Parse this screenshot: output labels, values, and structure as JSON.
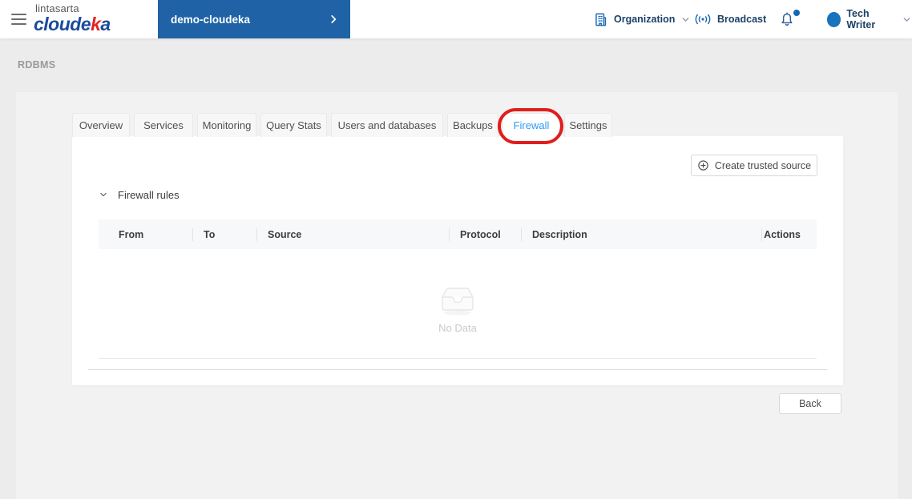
{
  "header": {
    "brand": {
      "top": "lintasarta",
      "name_prefix": "cloude",
      "name_accent": "k",
      "name_suffix": "a"
    },
    "project": {
      "label": "demo-cloudeka"
    },
    "organization_label": "Organization",
    "broadcast_label": "Broadcast",
    "user_name": "Tech Writer",
    "notification_dot": true
  },
  "breadcrumb": "RDBMS",
  "tabs": [
    {
      "label": "Overview",
      "active": false
    },
    {
      "label": "Services",
      "active": false
    },
    {
      "label": "Monitoring",
      "active": false
    },
    {
      "label": "Query Stats",
      "active": false
    },
    {
      "label": "Users and databases",
      "active": false
    },
    {
      "label": "Backups",
      "active": false
    },
    {
      "label": "Firewall",
      "active": true,
      "annotated": "red-circle"
    },
    {
      "label": "Settings",
      "active": false
    }
  ],
  "content": {
    "create_button_label": "Create trusted source",
    "section_title": "Firewall rules",
    "table": {
      "headers": [
        "From",
        "To",
        "Source",
        "Protocol",
        "Description",
        "Actions"
      ],
      "rows": []
    },
    "empty_text": "No Data",
    "back_label": "Back"
  },
  "colors": {
    "brand_blue": "#1a4b9d",
    "brand_red": "#e42320",
    "banner_blue": "#1f63a6",
    "nav_text": "#1d4066",
    "icon_blue": "#1a6ab5",
    "active_tab": "#2e9bf5",
    "annotation_red": "#e01e1e",
    "page_bg": "#ececec",
    "panel_bg": "#f1f2f1",
    "table_header_bg": "#f7f8f9"
  }
}
